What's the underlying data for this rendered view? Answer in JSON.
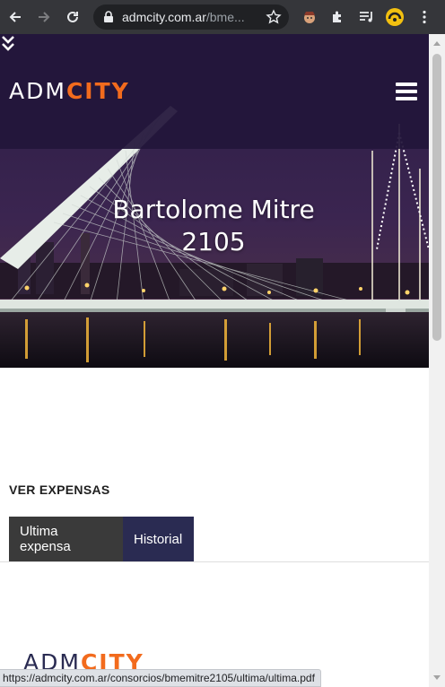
{
  "browser": {
    "url_host": "admcity.com.ar",
    "url_path": "/bme...",
    "icons": [
      "back-arrow-icon",
      "forward-arrow-icon",
      "reload-icon",
      "lock-icon",
      "star-icon",
      "avatar-extension-icon",
      "puzzle-extension-icon",
      "media-queue-icon",
      "profile-avatar-icon",
      "kebab-menu-icon"
    ]
  },
  "header": {
    "logo_part1": "ADM",
    "logo_part2": "CITY",
    "menu_icon": "hamburger-menu-icon"
  },
  "hero": {
    "title_line1": "Bartolome Mitre",
    "title_line2": "2105",
    "scroll_icon": "double-chevron-down-icon"
  },
  "expensas": {
    "section_title": "VER EXPENSAS",
    "tabs": [
      {
        "label": "Ultima expensa"
      },
      {
        "label": "Historial"
      }
    ]
  },
  "footer": {
    "logo_part1": "ADM",
    "logo_part2": "CITY"
  },
  "status_bar": {
    "link_url": "https://admcity.com.ar/consorcios/bmemitre2105/ultima/ultima.pdf"
  },
  "colors": {
    "accent_orange": "#f26b1d",
    "brand_navy": "#2a2b52",
    "tab_dark": "#3a3a3a",
    "header_purple": "#22163a"
  }
}
